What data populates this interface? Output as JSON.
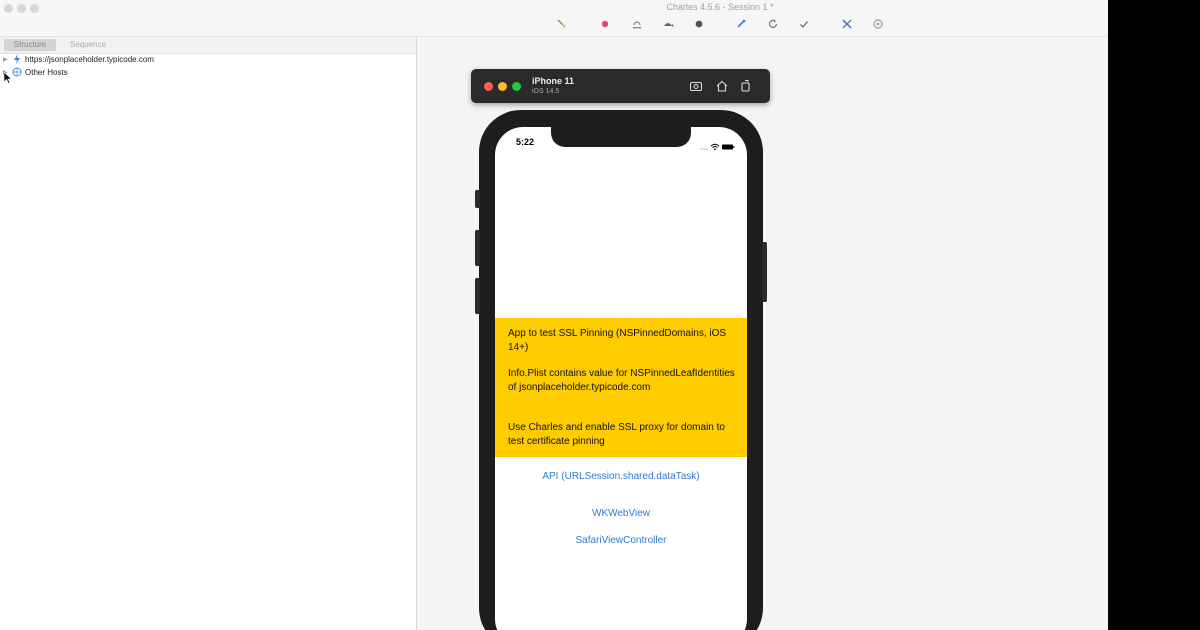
{
  "window": {
    "title": "Charles 4.5.6 - Session 1 *"
  },
  "toolbar": {
    "icons": [
      "broom-icon",
      "record-icon",
      "throttle-icon",
      "turtle-icon",
      "breakpoint-icon",
      "compose-icon",
      "repeat-icon",
      "validate-icon",
      "tools-icon",
      "settings-icon"
    ]
  },
  "left_panel": {
    "tabs": [
      {
        "label": "Structure",
        "active": true
      },
      {
        "label": "Sequence",
        "active": false
      }
    ],
    "tree": [
      {
        "label": "https://jsonplaceholder.typicode.com",
        "icon": "lightning-icon"
      },
      {
        "label": "Other Hosts",
        "icon": "globe-icon"
      }
    ]
  },
  "simulator": {
    "device_name": "iPhone 11",
    "os_version": "iOS 14.5",
    "icons": [
      "screenshot-icon",
      "home-icon",
      "rotate-icon"
    ]
  },
  "phone": {
    "time": "5:22",
    "banner": {
      "line1": "App to test SSL Pinning (NSPinnedDomains, iOS 14+)",
      "line2": "Info.Plist contains value for NSPinnedLeafIdentities of jsonplaceholder.typicode.com",
      "line3": "Use Charles and enable SSL proxy for domain to test certificate pinning"
    },
    "buttons": {
      "api": "API (URLSession.shared.dataTask)",
      "wkwebview": "WKWebView",
      "safari": "SafariViewController"
    }
  },
  "colors": {
    "banner": "#ffcc00",
    "link": "#2f7bd4",
    "close": "#ff5f57",
    "minimize": "#febc2e",
    "zoom": "#28c840"
  }
}
